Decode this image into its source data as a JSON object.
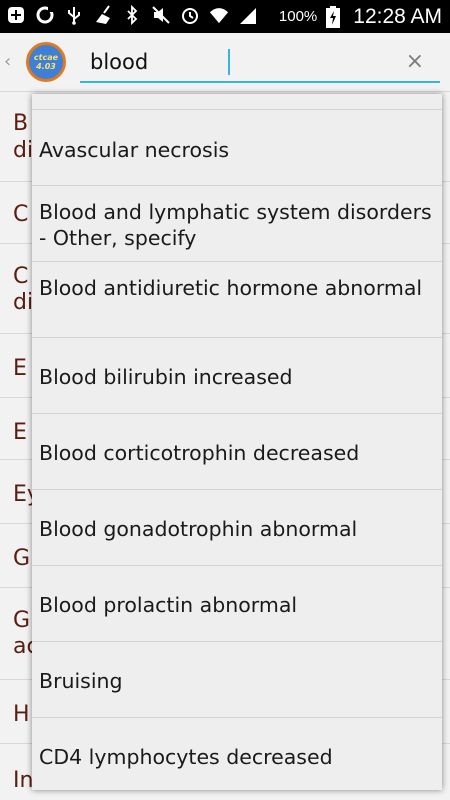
{
  "status_bar": {
    "battery_percent": "100%",
    "time": "12:28 AM",
    "icons": [
      "add-icon",
      "sync-icon",
      "usb-icon",
      "cleaner-icon",
      "bluetooth-icon",
      "mute-icon",
      "alarm-icon",
      "wifi-icon",
      "signal-icon",
      "battery-charging-icon"
    ]
  },
  "app_bar": {
    "logo_line1": "ctcae",
    "logo_line2": "4.03",
    "search_value": "blood",
    "clear_label": "×",
    "back_label": "‹"
  },
  "background_list": [
    {
      "text": "B"
    },
    {
      "text": "di"
    },
    {
      "text": "C"
    },
    {
      "text": "C"
    },
    {
      "text": "di"
    },
    {
      "text": "E"
    },
    {
      "text": "E"
    },
    {
      "text": "Ey"
    },
    {
      "text": "G"
    },
    {
      "text": "G"
    },
    {
      "text": "ac"
    },
    {
      "text": "H"
    },
    {
      "text": "In"
    }
  ],
  "suggestions": [
    "Avascular necrosis",
    "Blood and lymphatic system disorders - Other, specify",
    "Blood antidiuretic hormone abnormal",
    "Blood bilirubin increased",
    "Blood corticotrophin decreased",
    "Blood gonadotrophin abnormal",
    "Blood prolactin abnormal",
    "Bruising",
    "CD4 lymphocytes decreased"
  ],
  "colors": {
    "accent": "#33b5e5",
    "list_text": "#5a1e0f",
    "logo_blue": "#3f7fd6",
    "logo_ring": "#e07a1f"
  }
}
